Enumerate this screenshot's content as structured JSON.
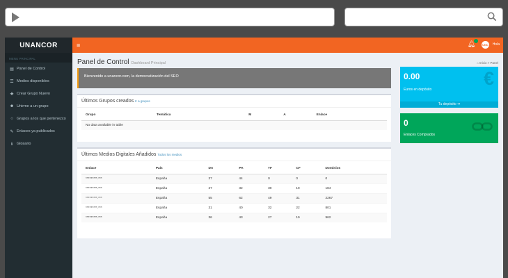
{
  "browser": {},
  "brand": {
    "name": "UNANCOR"
  },
  "topbar": {
    "user": "Hola"
  },
  "sidebar": {
    "header": "MENU PRINCIPAL",
    "items": [
      {
        "label": "Panel de Control",
        "icon": "dashboard-icon",
        "glyph": "▤"
      },
      {
        "label": "Medios disponibles",
        "icon": "list-icon",
        "glyph": "☰"
      },
      {
        "label": "Crear Grupo Nuevo",
        "icon": "plus-icon",
        "glyph": "✚"
      },
      {
        "label": "Unirme a un grupo",
        "icon": "users-icon",
        "glyph": "☻"
      },
      {
        "label": "Grupos a los que pertenezco",
        "icon": "circle-icon",
        "glyph": "○"
      },
      {
        "label": "Enlaces ya publicados",
        "icon": "link-icon",
        "glyph": "✎"
      },
      {
        "label": "Glosario",
        "icon": "info-icon",
        "glyph": "ℹ"
      }
    ]
  },
  "page": {
    "title": "Panel de Control",
    "subtitle": "Dashboard Principal",
    "breadcrumb": [
      "Inicio",
      "Panel"
    ]
  },
  "callout": {
    "text": "Bienvenido a unancor.com, la democratización del SEO"
  },
  "groups_box": {
    "title": "Últimos Grupos creados",
    "link": "Ir a grupos",
    "columns": [
      "Grupo",
      "Temática",
      "M",
      "A",
      "Enlace"
    ],
    "empty": "No data available in table"
  },
  "media_box": {
    "title": "Últimos Medios Digitales Añadidos",
    "link": "Todos los medios",
    "columns": [
      "Enlace",
      "País",
      "DA",
      "PA",
      "TF",
      "CF",
      "Dominios"
    ],
    "rows": [
      [
        "*********.***",
        "España",
        "37",
        "44",
        "0",
        "0",
        "0"
      ],
      [
        "*********.***",
        "España",
        "27",
        "32",
        "30",
        "19",
        "184"
      ],
      [
        "*********.***",
        "España",
        "55",
        "62",
        "49",
        "31",
        "2267"
      ],
      [
        "*********.***",
        "España",
        "31",
        "40",
        "32",
        "22",
        "801"
      ],
      [
        "*********.***",
        "España",
        "36",
        "43",
        "27",
        "19",
        "962"
      ]
    ]
  },
  "stat_deposit": {
    "value": "0.00",
    "label": "Euros en depósito",
    "footer": "Tu depósito",
    "color": "#00c0ef",
    "icon": "euro-icon"
  },
  "stat_links": {
    "value": "0",
    "label": "Enlaces Comprados",
    "color": "#00a65a",
    "icon": "chain-icon"
  }
}
